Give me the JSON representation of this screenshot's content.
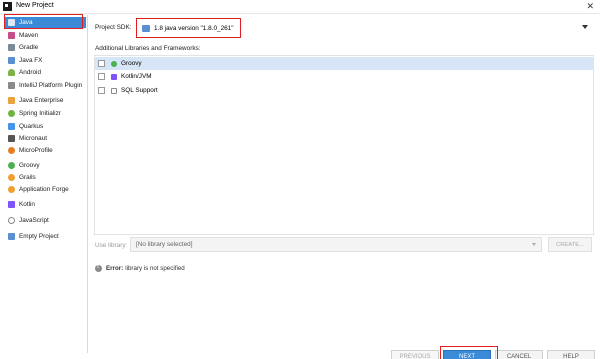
{
  "window": {
    "title": "New Project"
  },
  "sidebar": {
    "items": [
      {
        "label": "Java",
        "icon": "folder-icon",
        "color": "#4a90d9"
      },
      {
        "label": "Maven",
        "icon": "maven-icon",
        "color": "#c44d8a"
      },
      {
        "label": "Gradle",
        "icon": "gradle-icon",
        "color": "#7a8b99"
      },
      {
        "label": "Java FX",
        "icon": "javafx-icon",
        "color": "#5a8fd0"
      },
      {
        "label": "Android",
        "icon": "android-icon",
        "color": "#7cb342"
      },
      {
        "label": "IntelliJ Platform Plugin",
        "icon": "plugin-icon",
        "color": "#8a8a8a"
      },
      {
        "label": "Java Enterprise",
        "icon": "java-ee-icon",
        "color": "#e8a33d"
      },
      {
        "label": "Spring Initializr",
        "icon": "spring-icon",
        "color": "#6db33f"
      },
      {
        "label": "Quarkus",
        "icon": "quarkus-icon",
        "color": "#4695eb"
      },
      {
        "label": "Micronaut",
        "icon": "micronaut-icon",
        "color": "#555555"
      },
      {
        "label": "MicroProfile",
        "icon": "microprofile-icon",
        "color": "#e67e22"
      },
      {
        "label": "Groovy",
        "icon": "groovy-icon",
        "color": "#4caf50"
      },
      {
        "label": "Grails",
        "icon": "grails-icon",
        "color": "#f0a030"
      },
      {
        "label": "Application Forge",
        "icon": "forge-icon",
        "color": "#f0a030"
      },
      {
        "label": "Kotlin",
        "icon": "kotlin-icon",
        "color": "#7f52ff"
      },
      {
        "label": "JavaScript",
        "icon": "javascript-icon",
        "color": "#888888"
      },
      {
        "label": "Empty Project",
        "icon": "empty-project-icon",
        "color": "#5a8fd0"
      }
    ]
  },
  "sdk": {
    "label": "Project SDK:",
    "value": "1.8 java version \"1.8.0_261\""
  },
  "libraries": {
    "label": "Additional Libraries and Frameworks:",
    "items": [
      {
        "label": "Groovy",
        "icon": "groovy-icon",
        "color": "#4caf50"
      },
      {
        "label": "Kotlin/JVM",
        "icon": "kotlin-icon",
        "color": "#7f52ff"
      },
      {
        "label": "SQL Support",
        "icon": "sql-icon",
        "color": "#8a8a8a"
      }
    ]
  },
  "use_library": {
    "label": "Use library:",
    "value": "[No library selected]",
    "create_label": "CREATE..."
  },
  "error": {
    "prefix": "Error:",
    "message": "library is not specified"
  },
  "footer": {
    "previous_label": "PREVIOUS",
    "next_label": "NEXT",
    "cancel_label": "CANCEL",
    "help_label": "HELP"
  },
  "colors": {
    "accent": "#3b8ad8",
    "highlight_border": "#e02020"
  }
}
